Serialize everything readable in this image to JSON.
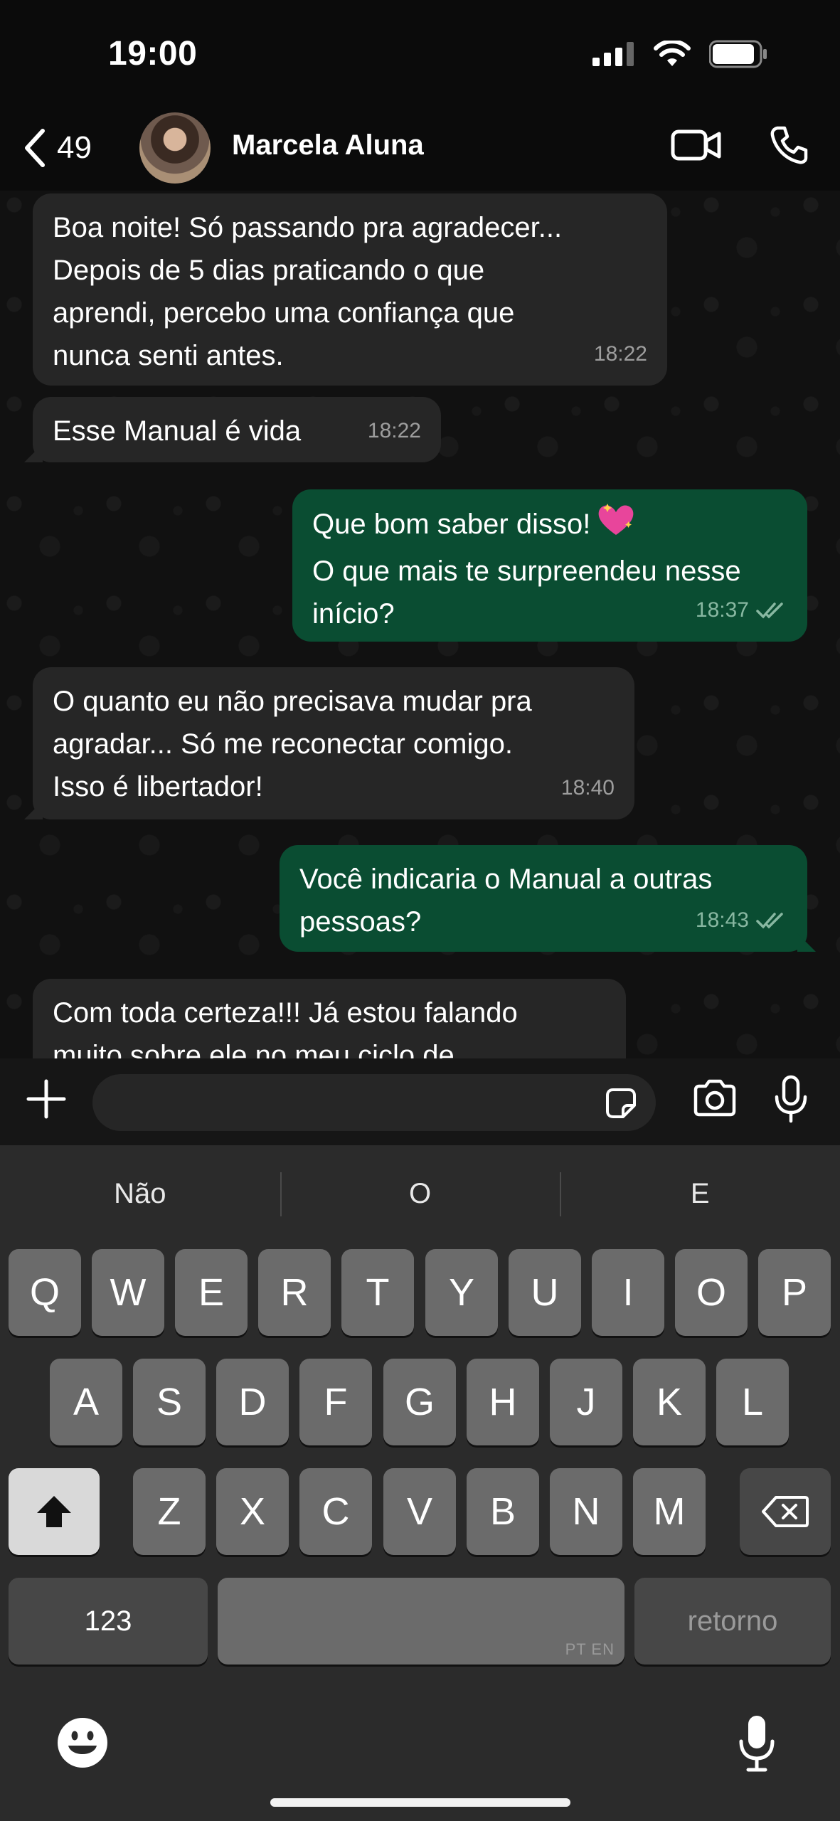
{
  "status_bar": {
    "time": "19:00"
  },
  "header": {
    "back_count": "49",
    "contact_name": "Marcela Aluna"
  },
  "messages": [
    {
      "direction": "in",
      "text_lines": [
        "Boa noite! Só passando pra agradecer...",
        "Depois de 5 dias praticando o que",
        "aprendi, percebo uma confiança que",
        "nunca senti antes."
      ],
      "time": "18:22"
    },
    {
      "direction": "in",
      "text_lines": [
        "Esse Manual é vida"
      ],
      "time": "18:22"
    },
    {
      "direction": "out",
      "text_lines": [
        "Que bom saber disso!",
        "O que mais te surpreendeu nesse",
        "início?"
      ],
      "time": "18:37",
      "read": true
    },
    {
      "direction": "in",
      "text_lines": [
        "O quanto eu não precisava mudar pra",
        "agradar... Só me reconectar comigo.",
        "Isso é libertador!"
      ],
      "time": "18:40"
    },
    {
      "direction": "out",
      "text_lines": [
        "Você indicaria o Manual a outras",
        "pessoas?"
      ],
      "time": "18:43",
      "read": true
    },
    {
      "direction": "in",
      "text_lines": [
        "Com toda certeza!!! Já estou falando",
        "muito sobre ele no meu ciclo de"
      ],
      "time": ""
    }
  ],
  "input": {
    "placeholder": ""
  },
  "keyboard": {
    "suggestions": [
      "Não",
      "O",
      "E"
    ],
    "row1": [
      "Q",
      "W",
      "E",
      "R",
      "T",
      "Y",
      "U",
      "I",
      "O",
      "P"
    ],
    "row2": [
      "A",
      "S",
      "D",
      "F",
      "G",
      "H",
      "J",
      "K",
      "L"
    ],
    "row3": [
      "Z",
      "X",
      "C",
      "V",
      "B",
      "N",
      "M"
    ],
    "numbers_key": "123",
    "space_lang": "PT EN",
    "return_key": "retorno"
  },
  "icons": [
    "back-chevron-icon",
    "video-call-icon",
    "phone-icon",
    "plus-icon",
    "sticker-icon",
    "camera-icon",
    "mic-icon",
    "shift-icon",
    "backspace-icon",
    "emoji-icon",
    "dictation-icon",
    "read-receipt-icon",
    "sparkling-heart-icon"
  ],
  "colors": {
    "incoming_bubble": "#262626",
    "outgoing_bubble": "#0a4d32",
    "background": "#0b0b0b"
  }
}
